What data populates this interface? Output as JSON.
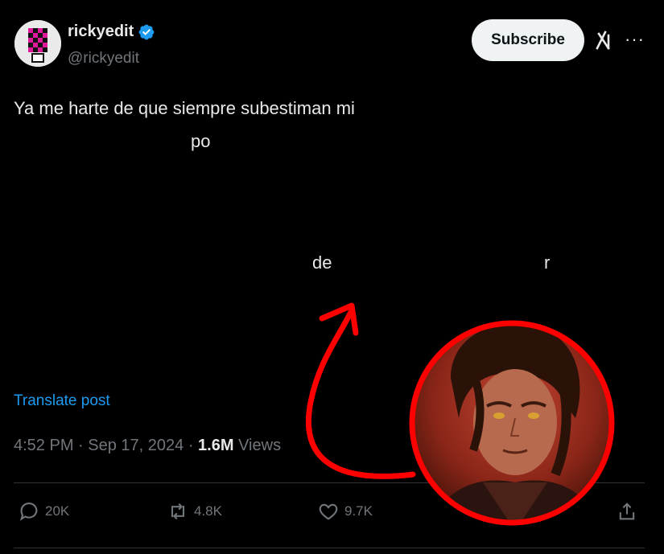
{
  "author": {
    "display_name": "rickyedit",
    "handle": "@rickyedit",
    "verified_icon": "verified-badge-icon"
  },
  "header": {
    "subscribe_label": "Subscribe",
    "grok_icon": "grok-icon",
    "more_icon": "more-icon"
  },
  "tweet": {
    "lines": [
      "Ya me harte de que siempre subestiman mi",
      "po",
      "de",
      "r"
    ],
    "translate_label": "Translate post",
    "time": "4:52 PM",
    "date": "Sep 17, 2024",
    "views_count": "1.6M",
    "views_label": "Views"
  },
  "actions": {
    "replies": "20K",
    "reposts": "4.8K",
    "likes": "9.7K"
  },
  "overlay": {
    "arrow_color": "#ff0000",
    "circle_color": "#ff0000",
    "image_description_icon": "meme-face-icon"
  },
  "colors": {
    "background": "#000000",
    "text": "#e7e9ea",
    "muted": "#71767b",
    "link": "#1d9bf0",
    "verified": "#1d9bf0"
  }
}
